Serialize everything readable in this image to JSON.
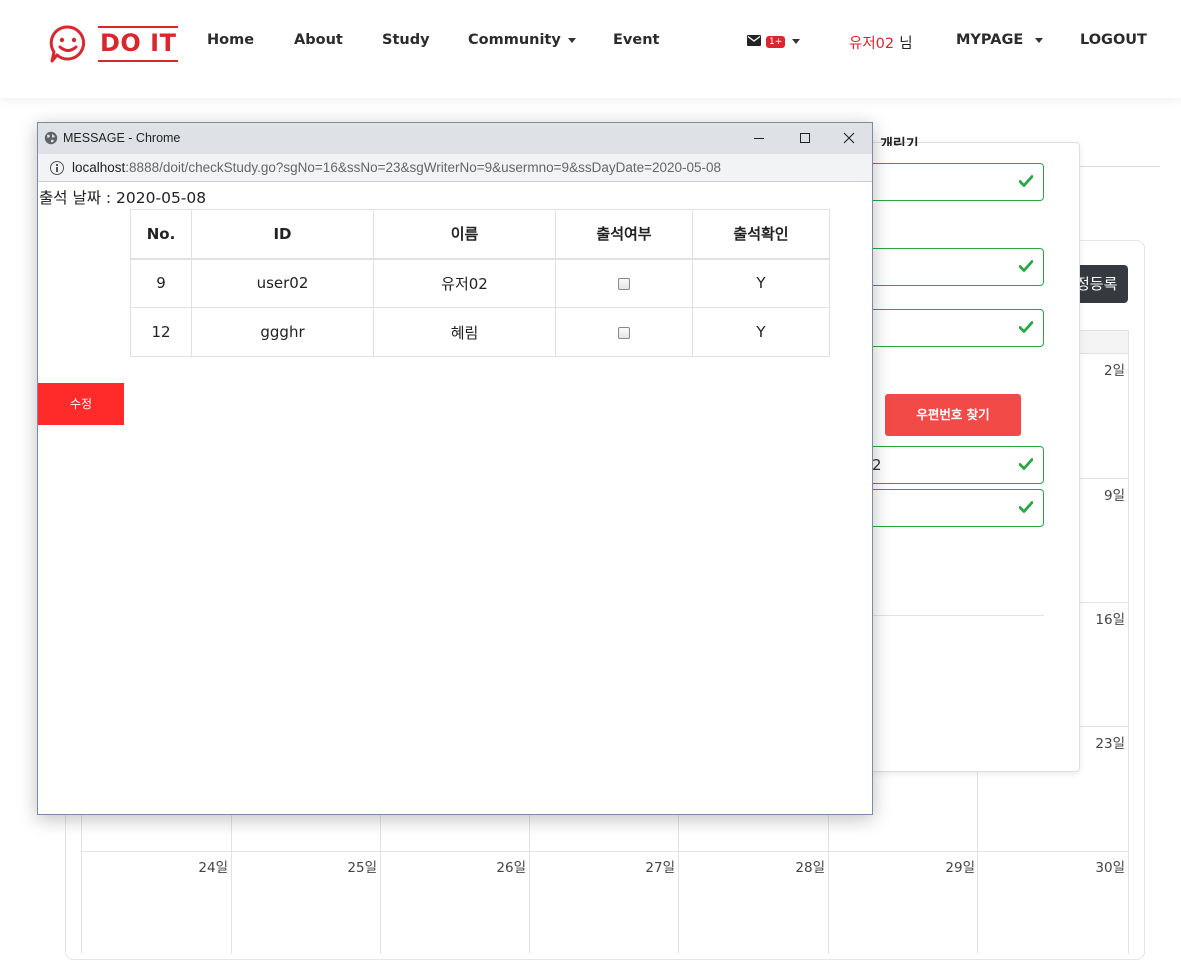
{
  "header": {
    "logo_text": "DO IT",
    "nav": [
      "Home",
      "About",
      "Study",
      "Community",
      "Event"
    ],
    "message_badge": "1+",
    "user_name": "유저02",
    "user_suffix": "님",
    "mypage": "MYPAGE",
    "logout": "LOGOUT"
  },
  "background": {
    "form_title_partial": "개린기",
    "register_button_partial": "정등록",
    "zip_button": "우편번호 찾기",
    "field_partial_value": "2",
    "calendar_days": [
      "2일",
      "9일",
      "16일",
      "23일",
      "24일",
      "25일",
      "26일",
      "27일",
      "28일",
      "29일",
      "30일"
    ]
  },
  "popup": {
    "title": "MESSAGE - Chrome",
    "url_host": "localhost",
    "url_rest": ":8888/doit/checkStudy.go?sgNo=16&ssNo=23&sgWriterNo=9&usermno=9&ssDayDate=2020-05-08",
    "date_label": "출석 날짜 : ",
    "date_value": "2020-05-08",
    "table": {
      "columns": [
        "No.",
        "ID",
        "이름",
        "출석여부",
        "출석확인"
      ],
      "rows": [
        {
          "no": "9",
          "id": "user02",
          "name": "유저02",
          "checked": false,
          "confirm": "Y"
        },
        {
          "no": "12",
          "id": "ggghr",
          "name": "혜림",
          "checked": false,
          "confirm": "Y"
        }
      ]
    },
    "edit_button": "수정"
  },
  "colors": {
    "brand_red": "#d9272e",
    "valid_green": "#28a745",
    "edit_red": "#ff2b2b",
    "zip_red": "#f24b47",
    "dark_button": "#343a40"
  }
}
